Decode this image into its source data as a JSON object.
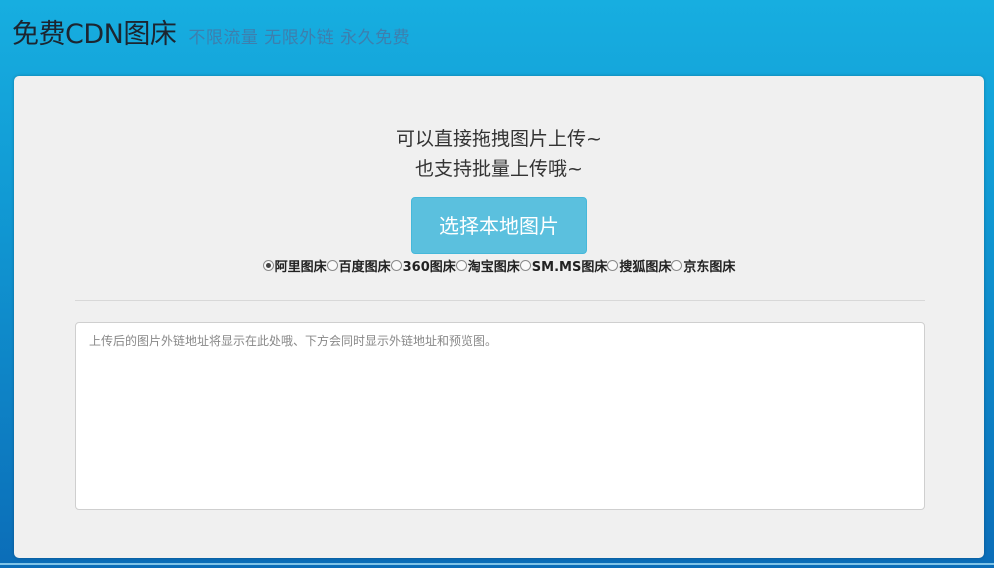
{
  "header": {
    "title": "免费CDN图床",
    "tagline": "不限流量 无限外链 永久免费"
  },
  "upload": {
    "hint_line1": "可以直接拖拽图片上传~",
    "hint_line2": "也支持批量上传哦~",
    "button_label": "选择本地图片"
  },
  "hosts": {
    "selected": "阿里图床",
    "options": [
      {
        "label": "阿里图床",
        "checked": true
      },
      {
        "label": "百度图床",
        "checked": false
      },
      {
        "label": "360图床",
        "checked": false
      },
      {
        "label": "淘宝图床",
        "checked": false
      },
      {
        "label": "SM.MS图床",
        "checked": false
      },
      {
        "label": "搜狐图床",
        "checked": false
      },
      {
        "label": "京东图床",
        "checked": false
      }
    ]
  },
  "result": {
    "value": "",
    "placeholder": "上传后的图片外链地址将显示在此处哦、下方会同时显示外链地址和预览图。"
  },
  "colors": {
    "background_top": "#17aee0",
    "background_bottom": "#0b6db8",
    "button": "#5bc0de",
    "panel": "#f0f0f0"
  }
}
